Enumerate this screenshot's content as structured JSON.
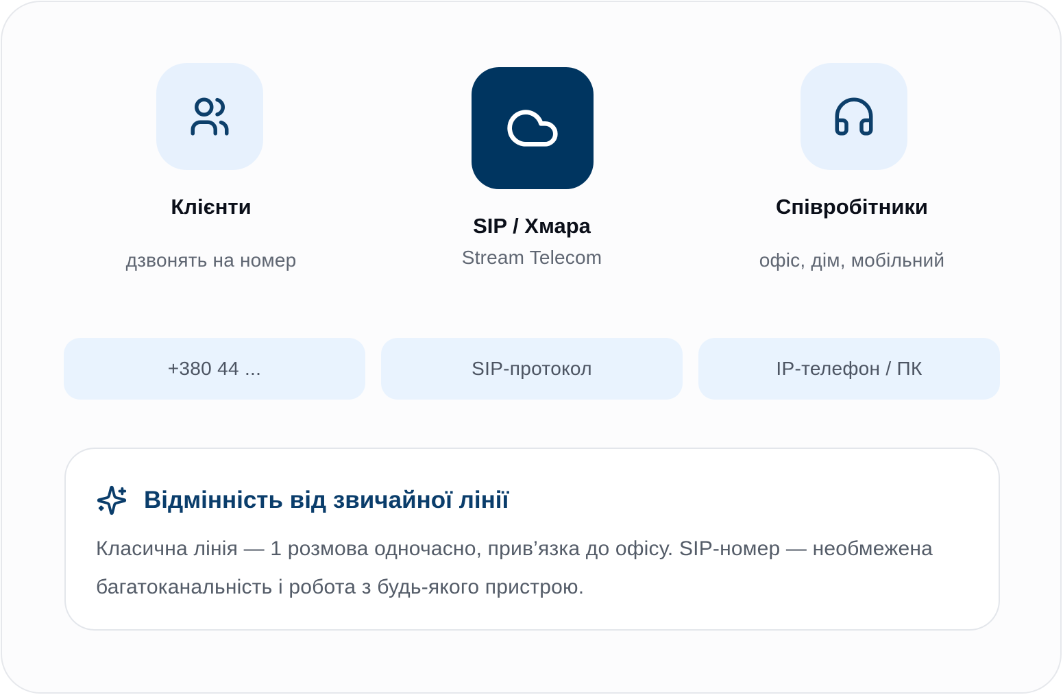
{
  "nodes": {
    "clients": {
      "title": "Клієнти",
      "subtitle": "дзвонять на номер",
      "icon": "users-icon"
    },
    "sip": {
      "title": "SIP / Хмара",
      "subtitle": "Stream Telecom",
      "icon": "cloud-icon"
    },
    "staff": {
      "title": "Співробітники",
      "subtitle": "офіс, дім, мобільний",
      "icon": "headphones-icon"
    }
  },
  "pills": {
    "number": "+380 44 ...",
    "protocol": "SIP-протокол",
    "device": "IP-телефон / ПК"
  },
  "callout": {
    "icon": "sparkles-icon",
    "title": "Відмінність від звичайної лінії",
    "body": "Класична лінія — 1 розмова одночасно, прив’язка до офісу. SIP-номер — необмежена багатоканальність і робота з будь-якого пристрою."
  },
  "colors": {
    "tile_light": "#e7f1fd",
    "tile_dark": "#003560",
    "icon_dark": "#0d3f6a",
    "callout_title": "#0a3d6b"
  }
}
